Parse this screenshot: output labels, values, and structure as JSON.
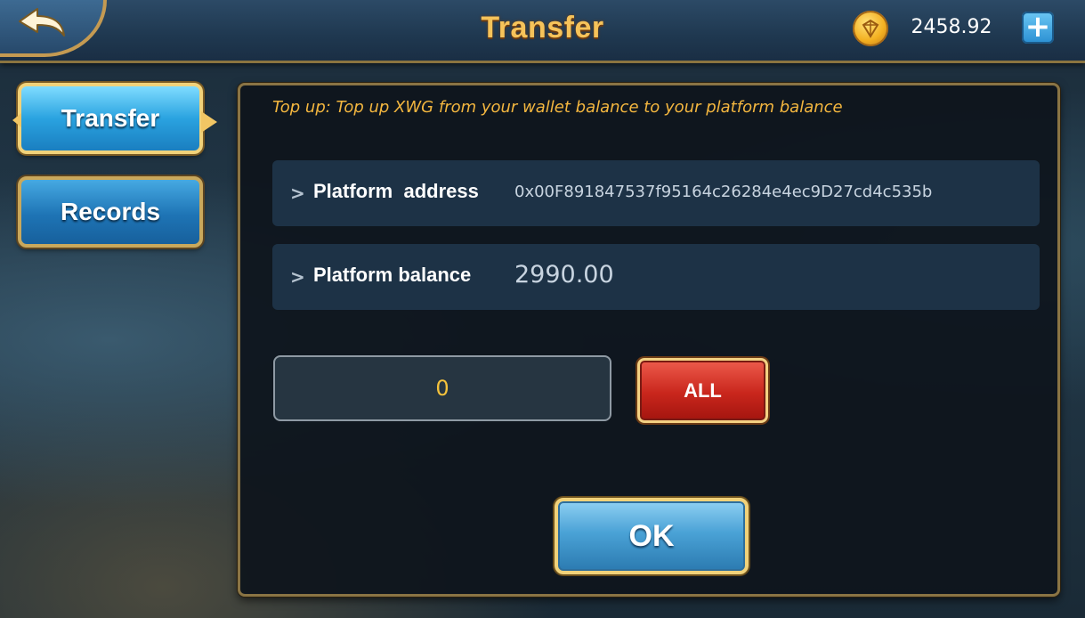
{
  "header": {
    "title": "Transfer",
    "balance": "2458.92",
    "back_icon": "back-arrow-icon",
    "coin_icon": "coin-icon",
    "plus_label": "+"
  },
  "sidebar": {
    "items": [
      {
        "label": "Transfer",
        "active": true
      },
      {
        "label": "Records",
        "active": false
      }
    ]
  },
  "main": {
    "hint": "Top up: Top up XWG from your wallet balance to your platform balance",
    "address_label": "Platform  address",
    "address_value": "0x00F891847537f95164c26284e4ec9D27cd4c535b",
    "balance_label": "Platform balance",
    "balance_value": "2990.00",
    "amount_value": "0",
    "all_label": "ALL",
    "ok_label": "OK",
    "chevron": ">"
  },
  "colors": {
    "title": "#f6c35a",
    "hint": "#f3b63f",
    "amount": "#f4c23c",
    "all_button": "#c9261c",
    "ok_button": "#4aa2d6"
  }
}
